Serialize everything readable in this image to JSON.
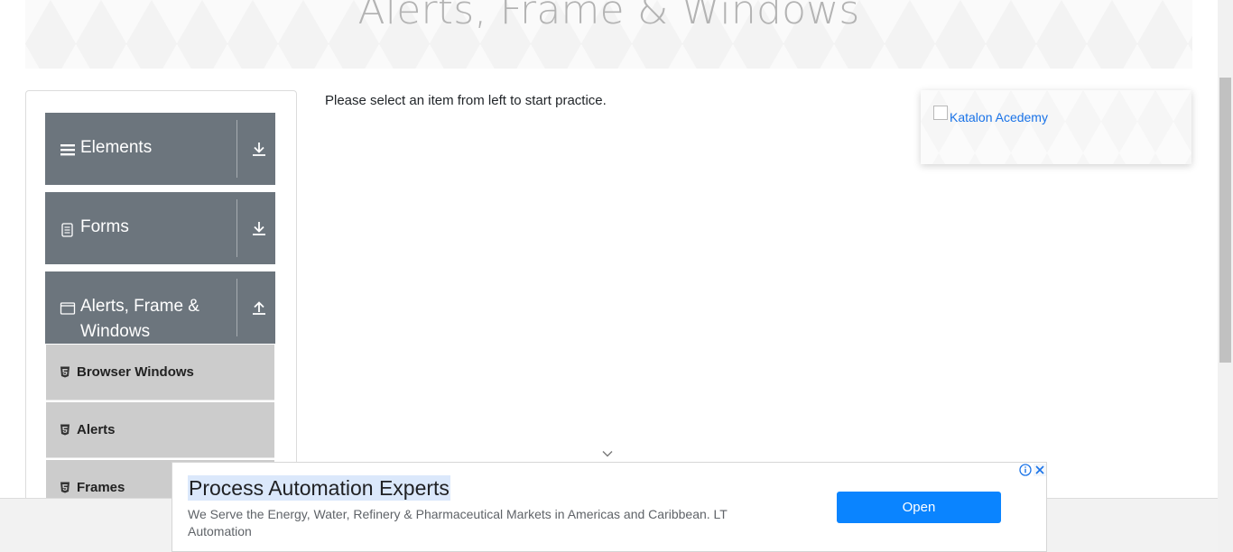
{
  "banner": {
    "title": "Alerts, Frame & Windows"
  },
  "sidebar": {
    "groups": [
      {
        "label": "Elements",
        "icon": "menu-icon",
        "toggle_icon": "download-arrow-icon"
      },
      {
        "label": "Forms",
        "icon": "document-icon",
        "toggle_icon": "download-arrow-icon"
      },
      {
        "label": "Alerts, Frame &",
        "label_line2": "Windows",
        "icon": "window-icon",
        "toggle_icon": "upload-arrow-icon"
      }
    ],
    "items": [
      {
        "label": "Browser Windows",
        "icon": "html5-icon"
      },
      {
        "label": "Alerts",
        "icon": "html5-icon"
      },
      {
        "label": "Frames",
        "icon": "html5-icon"
      }
    ]
  },
  "main": {
    "instruction": "Please select an item from left to start practice."
  },
  "side_ad": {
    "image_alt": "Katalon Acedemy"
  },
  "bottom_ad": {
    "title": "Process Automation Experts",
    "description": "We Serve the Energy, Water, Refinery & Pharmaceutical Markets in Americas and Caribbean. LT Automation",
    "button_label": "Open"
  },
  "colors": {
    "group_header_bg": "#6c757d",
    "sub_item_bg": "#cccccc",
    "open_button": "#0a84ff",
    "link": "#1a73e8"
  }
}
